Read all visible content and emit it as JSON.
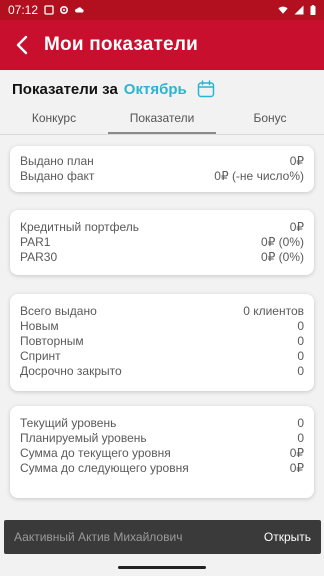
{
  "status": {
    "time": "07:12"
  },
  "appbar": {
    "title": "Мои показатели"
  },
  "period": {
    "label": "Показатели за",
    "month": "Октябрь"
  },
  "tabs": [
    {
      "label": "Конкурс"
    },
    {
      "label": "Показатели"
    },
    {
      "label": "Бонус"
    }
  ],
  "cards": {
    "issued": [
      {
        "label": "Выдано план",
        "value": "0₽"
      },
      {
        "label": "Выдано факт",
        "value": "0₽ (-не число%)"
      }
    ],
    "portfolio": [
      {
        "label": "Кредитный портфель",
        "value": "0₽"
      },
      {
        "label": "PAR1",
        "value": "0₽ (0%)"
      },
      {
        "label": "PAR30",
        "value": "0₽ (0%)"
      }
    ],
    "clients": [
      {
        "label": "Всего выдано",
        "value": "0 клиентов"
      },
      {
        "label": "Новым",
        "value": "0"
      },
      {
        "label": "Повторным",
        "value": "0"
      },
      {
        "label": "Спринт",
        "value": "0"
      },
      {
        "label": "Досрочно закрыто",
        "value": "0"
      }
    ],
    "levels": [
      {
        "label": "Текущий уровень",
        "value": "0"
      },
      {
        "label": "Планируемый уровень",
        "value": "0"
      },
      {
        "label": "Сумма до текущего уровня",
        "value": "0₽"
      },
      {
        "label": "Сумма до следующего уровня",
        "value": "0₽"
      }
    ]
  },
  "bottom": {
    "name": "Аактивный Актив Михайлович",
    "action": "Открыть"
  },
  "colors": {
    "primary": "#c8102e",
    "accent": "#2bb4d2"
  }
}
